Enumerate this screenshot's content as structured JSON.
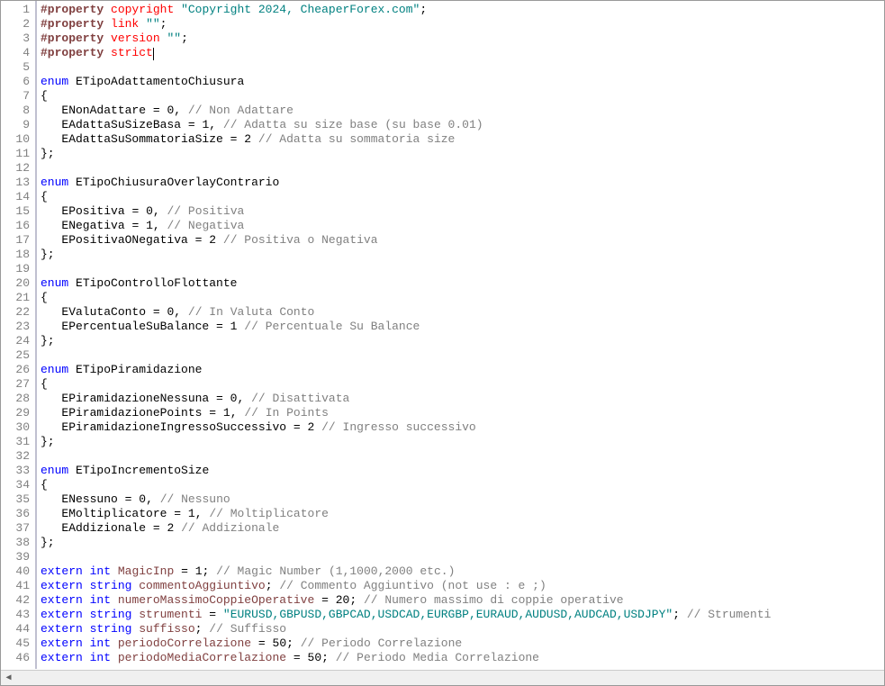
{
  "lines": [
    {
      "n": 1,
      "tokens": [
        [
          "dir",
          "#property"
        ],
        [
          "_",
          " "
        ],
        [
          "dname",
          "copyright"
        ],
        [
          "_",
          " "
        ],
        [
          "str",
          "\"Copyright 2024, CheaperForex.com\""
        ],
        [
          "op",
          ";"
        ]
      ]
    },
    {
      "n": 2,
      "tokens": [
        [
          "dir",
          "#property"
        ],
        [
          "_",
          " "
        ],
        [
          "dname",
          "link"
        ],
        [
          "_",
          " "
        ],
        [
          "str",
          "\"\""
        ],
        [
          "op",
          ";"
        ]
      ]
    },
    {
      "n": 3,
      "tokens": [
        [
          "dir",
          "#property"
        ],
        [
          "_",
          " "
        ],
        [
          "dname",
          "version"
        ],
        [
          "_",
          " "
        ],
        [
          "str",
          "\"\""
        ],
        [
          "op",
          ";"
        ]
      ]
    },
    {
      "n": 4,
      "tokens": [
        [
          "dir",
          "#property"
        ],
        [
          "_",
          " "
        ],
        [
          "dname",
          "strict"
        ]
      ],
      "cursor": true
    },
    {
      "n": 5,
      "tokens": []
    },
    {
      "n": 6,
      "tokens": [
        [
          "kw",
          "enum"
        ],
        [
          "_",
          " "
        ],
        [
          "id",
          "ETipoAdattamentoChiusura"
        ]
      ]
    },
    {
      "n": 7,
      "tokens": [
        [
          "op",
          "{"
        ]
      ]
    },
    {
      "n": 8,
      "tokens": [
        [
          "_",
          "   "
        ],
        [
          "id",
          "ENonAdattare"
        ],
        [
          "_",
          " "
        ],
        [
          "op",
          "="
        ],
        [
          "_",
          " "
        ],
        [
          "num",
          "0"
        ],
        [
          "op",
          ","
        ],
        [
          "_",
          " "
        ],
        [
          "cmt",
          "// Non Adattare"
        ]
      ]
    },
    {
      "n": 9,
      "tokens": [
        [
          "_",
          "   "
        ],
        [
          "id",
          "EAdattaSuSizeBasa"
        ],
        [
          "_",
          " "
        ],
        [
          "op",
          "="
        ],
        [
          "_",
          " "
        ],
        [
          "num",
          "1"
        ],
        [
          "op",
          ","
        ],
        [
          "_",
          " "
        ],
        [
          "cmt",
          "// Adatta su size base (su base 0.01)"
        ]
      ]
    },
    {
      "n": 10,
      "tokens": [
        [
          "_",
          "   "
        ],
        [
          "id",
          "EAdattaSuSommatoriaSize"
        ],
        [
          "_",
          " "
        ],
        [
          "op",
          "="
        ],
        [
          "_",
          " "
        ],
        [
          "num",
          "2"
        ],
        [
          "_",
          " "
        ],
        [
          "cmt",
          "// Adatta su sommatoria size"
        ]
      ]
    },
    {
      "n": 11,
      "tokens": [
        [
          "op",
          "};"
        ]
      ]
    },
    {
      "n": 12,
      "tokens": []
    },
    {
      "n": 13,
      "tokens": [
        [
          "kw",
          "enum"
        ],
        [
          "_",
          " "
        ],
        [
          "id",
          "ETipoChiusuraOverlayContrario"
        ]
      ]
    },
    {
      "n": 14,
      "tokens": [
        [
          "op",
          "{"
        ]
      ]
    },
    {
      "n": 15,
      "tokens": [
        [
          "_",
          "   "
        ],
        [
          "id",
          "EPositiva"
        ],
        [
          "_",
          " "
        ],
        [
          "op",
          "="
        ],
        [
          "_",
          " "
        ],
        [
          "num",
          "0"
        ],
        [
          "op",
          ","
        ],
        [
          "_",
          " "
        ],
        [
          "cmt",
          "// Positiva"
        ]
      ]
    },
    {
      "n": 16,
      "tokens": [
        [
          "_",
          "   "
        ],
        [
          "id",
          "ENegativa"
        ],
        [
          "_",
          " "
        ],
        [
          "op",
          "="
        ],
        [
          "_",
          " "
        ],
        [
          "num",
          "1"
        ],
        [
          "op",
          ","
        ],
        [
          "_",
          " "
        ],
        [
          "cmt",
          "// Negativa"
        ]
      ]
    },
    {
      "n": 17,
      "tokens": [
        [
          "_",
          "   "
        ],
        [
          "id",
          "EPositivaONegativa"
        ],
        [
          "_",
          " "
        ],
        [
          "op",
          "="
        ],
        [
          "_",
          " "
        ],
        [
          "num",
          "2"
        ],
        [
          "_",
          " "
        ],
        [
          "cmt",
          "// Positiva o Negativa"
        ]
      ]
    },
    {
      "n": 18,
      "tokens": [
        [
          "op",
          "};"
        ]
      ]
    },
    {
      "n": 19,
      "tokens": []
    },
    {
      "n": 20,
      "tokens": [
        [
          "kw",
          "enum"
        ],
        [
          "_",
          " "
        ],
        [
          "id",
          "ETipoControlloFlottante"
        ]
      ]
    },
    {
      "n": 21,
      "tokens": [
        [
          "op",
          "{"
        ]
      ]
    },
    {
      "n": 22,
      "tokens": [
        [
          "_",
          "   "
        ],
        [
          "id",
          "EValutaConto"
        ],
        [
          "_",
          " "
        ],
        [
          "op",
          "="
        ],
        [
          "_",
          " "
        ],
        [
          "num",
          "0"
        ],
        [
          "op",
          ","
        ],
        [
          "_",
          " "
        ],
        [
          "cmt",
          "// In Valuta Conto"
        ]
      ]
    },
    {
      "n": 23,
      "tokens": [
        [
          "_",
          "   "
        ],
        [
          "id",
          "EPercentualeSuBalance"
        ],
        [
          "_",
          " "
        ],
        [
          "op",
          "="
        ],
        [
          "_",
          " "
        ],
        [
          "num",
          "1"
        ],
        [
          "_",
          " "
        ],
        [
          "cmt",
          "// Percentuale Su Balance"
        ]
      ]
    },
    {
      "n": 24,
      "tokens": [
        [
          "op",
          "};"
        ]
      ]
    },
    {
      "n": 25,
      "tokens": []
    },
    {
      "n": 26,
      "tokens": [
        [
          "kw",
          "enum"
        ],
        [
          "_",
          " "
        ],
        [
          "id",
          "ETipoPiramidazione"
        ]
      ]
    },
    {
      "n": 27,
      "tokens": [
        [
          "op",
          "{"
        ]
      ]
    },
    {
      "n": 28,
      "tokens": [
        [
          "_",
          "   "
        ],
        [
          "id",
          "EPiramidazioneNessuna"
        ],
        [
          "_",
          " "
        ],
        [
          "op",
          "="
        ],
        [
          "_",
          " "
        ],
        [
          "num",
          "0"
        ],
        [
          "op",
          ","
        ],
        [
          "_",
          " "
        ],
        [
          "cmt",
          "// Disattivata"
        ]
      ]
    },
    {
      "n": 29,
      "tokens": [
        [
          "_",
          "   "
        ],
        [
          "id",
          "EPiramidazionePoints"
        ],
        [
          "_",
          " "
        ],
        [
          "op",
          "="
        ],
        [
          "_",
          " "
        ],
        [
          "num",
          "1"
        ],
        [
          "op",
          ","
        ],
        [
          "_",
          " "
        ],
        [
          "cmt",
          "// In Points"
        ]
      ]
    },
    {
      "n": 30,
      "tokens": [
        [
          "_",
          "   "
        ],
        [
          "id",
          "EPiramidazioneIngressoSuccessivo"
        ],
        [
          "_",
          " "
        ],
        [
          "op",
          "="
        ],
        [
          "_",
          " "
        ],
        [
          "num",
          "2"
        ],
        [
          "_",
          " "
        ],
        [
          "cmt",
          "// Ingresso successivo"
        ]
      ]
    },
    {
      "n": 31,
      "tokens": [
        [
          "op",
          "};"
        ]
      ]
    },
    {
      "n": 32,
      "tokens": []
    },
    {
      "n": 33,
      "tokens": [
        [
          "kw",
          "enum"
        ],
        [
          "_",
          " "
        ],
        [
          "id",
          "ETipoIncrementoSize"
        ]
      ]
    },
    {
      "n": 34,
      "tokens": [
        [
          "op",
          "{"
        ]
      ]
    },
    {
      "n": 35,
      "tokens": [
        [
          "_",
          "   "
        ],
        [
          "id",
          "ENessuno"
        ],
        [
          "_",
          " "
        ],
        [
          "op",
          "="
        ],
        [
          "_",
          " "
        ],
        [
          "num",
          "0"
        ],
        [
          "op",
          ","
        ],
        [
          "_",
          " "
        ],
        [
          "cmt",
          "// Nessuno"
        ]
      ]
    },
    {
      "n": 36,
      "tokens": [
        [
          "_",
          "   "
        ],
        [
          "id",
          "EMoltiplicatore"
        ],
        [
          "_",
          " "
        ],
        [
          "op",
          "="
        ],
        [
          "_",
          " "
        ],
        [
          "num",
          "1"
        ],
        [
          "op",
          ","
        ],
        [
          "_",
          " "
        ],
        [
          "cmt",
          "// Moltiplicatore"
        ]
      ]
    },
    {
      "n": 37,
      "tokens": [
        [
          "_",
          "   "
        ],
        [
          "id",
          "EAddizionale"
        ],
        [
          "_",
          " "
        ],
        [
          "op",
          "="
        ],
        [
          "_",
          " "
        ],
        [
          "num",
          "2"
        ],
        [
          "_",
          " "
        ],
        [
          "cmt",
          "// Addizionale"
        ]
      ]
    },
    {
      "n": 38,
      "tokens": [
        [
          "op",
          "};"
        ]
      ]
    },
    {
      "n": 39,
      "tokens": []
    },
    {
      "n": 40,
      "tokens": [
        [
          "kw",
          "extern"
        ],
        [
          "_",
          " "
        ],
        [
          "type",
          "int"
        ],
        [
          "_",
          " "
        ],
        [
          "var",
          "MagicInp"
        ],
        [
          "_",
          " "
        ],
        [
          "op",
          "="
        ],
        [
          "_",
          " "
        ],
        [
          "num",
          "1"
        ],
        [
          "op",
          ";"
        ],
        [
          "_",
          " "
        ],
        [
          "cmt",
          "// Magic Number (1,1000,2000 etc.)"
        ]
      ]
    },
    {
      "n": 41,
      "tokens": [
        [
          "kw",
          "extern"
        ],
        [
          "_",
          " "
        ],
        [
          "type",
          "string"
        ],
        [
          "_",
          " "
        ],
        [
          "var",
          "commentoAggiuntivo"
        ],
        [
          "op",
          ";"
        ],
        [
          "_",
          " "
        ],
        [
          "cmt",
          "// Commento Aggiuntivo (not use : e ;)"
        ]
      ]
    },
    {
      "n": 42,
      "tokens": [
        [
          "kw",
          "extern"
        ],
        [
          "_",
          " "
        ],
        [
          "type",
          "int"
        ],
        [
          "_",
          " "
        ],
        [
          "var",
          "numeroMassimoCoppieOperative"
        ],
        [
          "_",
          " "
        ],
        [
          "op",
          "="
        ],
        [
          "_",
          " "
        ],
        [
          "num",
          "20"
        ],
        [
          "op",
          ";"
        ],
        [
          "_",
          " "
        ],
        [
          "cmt",
          "// Numero massimo di coppie operative"
        ]
      ]
    },
    {
      "n": 43,
      "tokens": [
        [
          "kw",
          "extern"
        ],
        [
          "_",
          " "
        ],
        [
          "type",
          "string"
        ],
        [
          "_",
          " "
        ],
        [
          "var",
          "strumenti"
        ],
        [
          "_",
          " "
        ],
        [
          "op",
          "="
        ],
        [
          "_",
          " "
        ],
        [
          "str",
          "\"EURUSD,GBPUSD,GBPCAD,USDCAD,EURGBP,EURAUD,AUDUSD,AUDCAD,USDJPY\""
        ],
        [
          "op",
          ";"
        ],
        [
          "_",
          " "
        ],
        [
          "cmt",
          "// Strumenti"
        ]
      ]
    },
    {
      "n": 44,
      "tokens": [
        [
          "kw",
          "extern"
        ],
        [
          "_",
          " "
        ],
        [
          "type",
          "string"
        ],
        [
          "_",
          " "
        ],
        [
          "var",
          "suffisso"
        ],
        [
          "op",
          ";"
        ],
        [
          "_",
          " "
        ],
        [
          "cmt",
          "// Suffisso"
        ]
      ]
    },
    {
      "n": 45,
      "tokens": [
        [
          "kw",
          "extern"
        ],
        [
          "_",
          " "
        ],
        [
          "type",
          "int"
        ],
        [
          "_",
          " "
        ],
        [
          "var",
          "periodoCorrelazione"
        ],
        [
          "_",
          " "
        ],
        [
          "op",
          "="
        ],
        [
          "_",
          " "
        ],
        [
          "num",
          "50"
        ],
        [
          "op",
          ";"
        ],
        [
          "_",
          " "
        ],
        [
          "cmt",
          "// Periodo Correlazione"
        ]
      ]
    },
    {
      "n": 46,
      "tokens": [
        [
          "kw",
          "extern"
        ],
        [
          "_",
          " "
        ],
        [
          "type",
          "int"
        ],
        [
          "_",
          " "
        ],
        [
          "var",
          "periodoMediaCorrelazione"
        ],
        [
          "_",
          " "
        ],
        [
          "op",
          "="
        ],
        [
          "_",
          " "
        ],
        [
          "num",
          "50"
        ],
        [
          "op",
          ";"
        ],
        [
          "_",
          " "
        ],
        [
          "cmt",
          "// Periodo Media Correlazione"
        ]
      ]
    }
  ],
  "scrollbar": {
    "left_arrow": "◀",
    "right_arrow": "▶"
  }
}
